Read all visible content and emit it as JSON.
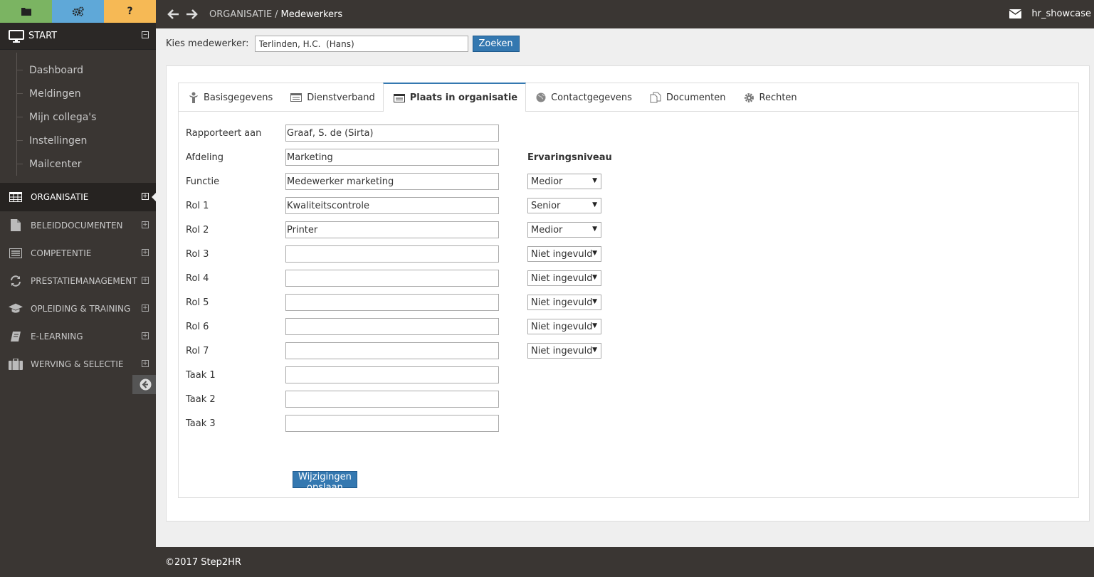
{
  "sidebar": {
    "top_buttons": [
      {
        "icon": "folder-icon",
        "color": "#7bb462"
      },
      {
        "icon": "gears-icon",
        "color": "#5fa8d8"
      },
      {
        "icon": "help-icon",
        "label": "?",
        "color": "#f6b955"
      }
    ],
    "start": {
      "label": "START",
      "toggle": "−"
    },
    "start_items": [
      "Dashboard",
      "Meldingen",
      "Mijn collega's",
      "Instellingen",
      "Mailcenter"
    ],
    "nav": [
      {
        "label": "ORGANISATIE",
        "icon": "table-icon",
        "active": true
      },
      {
        "label": "BELEIDDOCUMENTEN",
        "icon": "file-icon"
      },
      {
        "label": "COMPETENTIE",
        "icon": "list-icon"
      },
      {
        "label": "PRESTATIEMANAGEMENT",
        "icon": "refresh-icon"
      },
      {
        "label": "OPLEIDING & TRAINING",
        "icon": "graduation-cap-icon"
      },
      {
        "label": "E-LEARNING",
        "icon": "book-icon"
      },
      {
        "label": "WERVING & SELECTIE",
        "icon": "briefcase-icon"
      }
    ],
    "plus": "+"
  },
  "topbar": {
    "breadcrumb_parent": "ORGANISATIE",
    "breadcrumb_sep": "/",
    "breadcrumb_current": "Medewerkers",
    "username": "hr_showcase"
  },
  "search": {
    "label": "Kies medewerker:",
    "value": "Terlinden, H.C.  (Hans)",
    "button": "Zoeken"
  },
  "tabs": [
    {
      "label": "Basisgegevens",
      "icon": "person-icon"
    },
    {
      "label": "Dienstverband",
      "icon": "card-icon"
    },
    {
      "label": "Plaats in organisatie",
      "icon": "list-icon",
      "active": true
    },
    {
      "label": "Contactgegevens",
      "icon": "globe-icon"
    },
    {
      "label": "Documenten",
      "icon": "copy-icon"
    },
    {
      "label": "Rechten",
      "icon": "gear-icon"
    }
  ],
  "form": {
    "ervaring_label": "Ervaringsniveau",
    "rows": [
      {
        "label": "Rapporteert aan",
        "value": "Graaf, S. de (Sirta)"
      },
      {
        "label": "Afdeling",
        "value": "Marketing"
      },
      {
        "label": "Functie",
        "value": "Medewerker marketing",
        "level": "Medior"
      },
      {
        "label": "Rol 1",
        "value": "Kwaliteitscontrole",
        "level": "Senior"
      },
      {
        "label": "Rol 2",
        "value": "Printer",
        "level": "Medior"
      },
      {
        "label": "Rol 3",
        "value": "",
        "level": "Niet ingevuld"
      },
      {
        "label": "Rol 4",
        "value": "",
        "level": "Niet ingevuld"
      },
      {
        "label": "Rol 5",
        "value": "",
        "level": "Niet ingevuld"
      },
      {
        "label": "Rol 6",
        "value": "",
        "level": "Niet ingevuld"
      },
      {
        "label": "Rol 7",
        "value": "",
        "level": "Niet ingevuld"
      },
      {
        "label": "Taak 1",
        "value": ""
      },
      {
        "label": "Taak 2",
        "value": ""
      },
      {
        "label": "Taak 3",
        "value": ""
      }
    ],
    "caret": "▼",
    "save": "Wijzigingen opslaan"
  },
  "footer": {
    "text": "©2017 Step2HR"
  }
}
